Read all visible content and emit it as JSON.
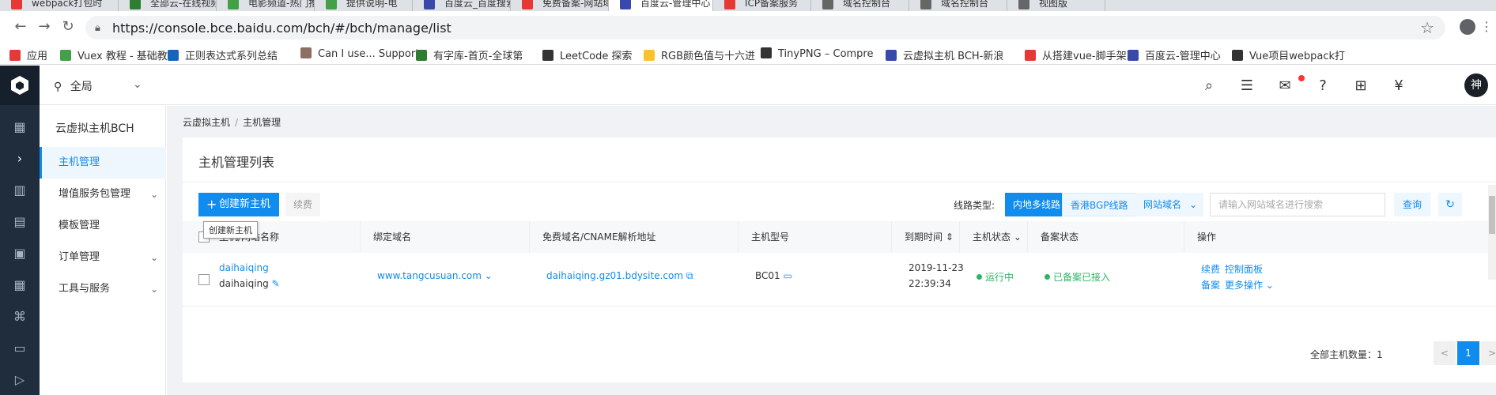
{
  "browser": {
    "tabs": [
      {
        "label": "webpack打包时",
        "color": "#e53935"
      },
      {
        "label": "全部云-在线视频",
        "color": "#2e7d32"
      },
      {
        "label": "电影频道-热门推",
        "color": "#43a047"
      },
      {
        "label": "提供说明-电",
        "color": "#43a047"
      },
      {
        "label": "百度云_百度搜索",
        "color": "#3949ab"
      },
      {
        "label": "免费备案-网站域",
        "color": "#e53935"
      },
      {
        "label": "百度云-管理中心",
        "color": "#3949ab"
      },
      {
        "label": "ICP备案服务",
        "color": "#e53935"
      },
      {
        "label": "域名控制台",
        "color": "#666"
      },
      {
        "label": "域名控制台",
        "color": "#666"
      },
      {
        "label": "视图版",
        "color": "#666"
      }
    ],
    "url": "https://console.bce.baidu.com/bch/#/bch/manage/list",
    "bookmarks": [
      {
        "label": "应用",
        "color": "#e53935"
      },
      {
        "label": "Vuex 教程 - 基础教程",
        "color": "#43a047"
      },
      {
        "label": "正则表达式系列总结",
        "color": "#1565c0"
      },
      {
        "label": "Can I use... Support",
        "color": "#8d6e63"
      },
      {
        "label": "有字库-首页-全球第",
        "color": "#2e7d32"
      },
      {
        "label": "LeetCode 探索",
        "color": "#333"
      },
      {
        "label": "RGB颜色值与十六进",
        "color": "#fbc02d"
      },
      {
        "label": "TinyPNG – Compre",
        "color": "#333"
      },
      {
        "label": "云虚拟主机 BCH-新浪",
        "color": "#3949ab"
      },
      {
        "label": "从搭建vue-脚手架到",
        "color": "#e53935"
      },
      {
        "label": "百度云-管理中心",
        "color": "#3949ab"
      },
      {
        "label": "Vue项目webpack打",
        "color": "#333"
      }
    ]
  },
  "topbar": {
    "region": "全局",
    "avatar": "神"
  },
  "sidenav": {
    "title": "云虚拟主机BCH",
    "items": [
      {
        "label": "主机管理",
        "active": true,
        "expandable": false
      },
      {
        "label": "增值服务包管理",
        "active": false,
        "expandable": true
      },
      {
        "label": "模板管理",
        "active": false,
        "expandable": false
      },
      {
        "label": "订单管理",
        "active": false,
        "expandable": true
      },
      {
        "label": "工具与服务",
        "active": false,
        "expandable": true
      }
    ]
  },
  "breadcrumb": {
    "items": [
      "云虚拟主机",
      "主机管理"
    ]
  },
  "card": {
    "title": "主机管理列表",
    "create_button": "创建新主机",
    "renew_button": "续费",
    "tooltip": "创建新主机",
    "line_type_label": "线路类型:",
    "line_types": [
      "内地多线路",
      "香港BGP线路"
    ],
    "select_value": "网站域名",
    "search_placeholder": "请输入网站域名进行搜索",
    "query_button": "查询"
  },
  "table": {
    "headers": [
      "主机/网站名称",
      "绑定域名",
      "免费域名/CNAME解析地址",
      "主机型号",
      "到期时间",
      "主机状态",
      "备案状态",
      "操作"
    ],
    "rows": [
      {
        "name_link": "daihaiqing",
        "name": "daihaiqing",
        "domain": "www.tangcusuan.com",
        "cname": "daihaiqing.gz01.bdysite.com",
        "model": "BC01",
        "expire_date": "2019-11-23",
        "expire_time": "22:39:34",
        "status": "运行中",
        "icp_status": "已备案已接入",
        "actions": [
          "续费",
          "控制面板",
          "备案",
          "更多操作"
        ]
      }
    ]
  },
  "pagination": {
    "total_label": "全部主机数量：",
    "total": "1",
    "current": "1",
    "prev": "<",
    "next": ">"
  },
  "colors": {
    "primary": "#108cee",
    "success": "#2cb663",
    "nav_dark": "#1f2d3d"
  }
}
